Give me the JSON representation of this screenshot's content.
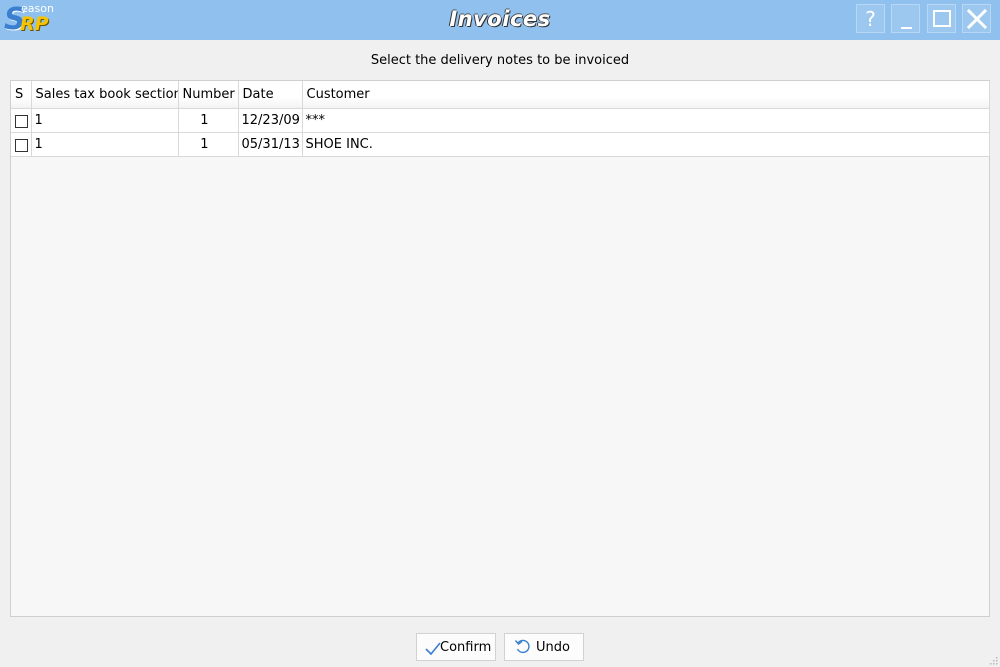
{
  "app": {
    "logo": {
      "big_letter": "S",
      "small_text": "eason",
      "accent_text": "RP"
    },
    "window_title": "Invoices",
    "help_label": "?"
  },
  "prompt": "Select the delivery notes to be invoiced",
  "grid": {
    "columns": [
      "S",
      "Sales tax book section",
      "Number",
      "Date",
      "Customer"
    ],
    "rows": [
      {
        "selected": false,
        "section": "1",
        "number": "1",
        "date": "12/23/09",
        "customer": "***"
      },
      {
        "selected": false,
        "section": "1",
        "number": "1",
        "date": "05/31/13",
        "customer": "SHOE INC."
      }
    ]
  },
  "buttons": {
    "confirm": "Confirm",
    "undo": "Undo"
  },
  "colors": {
    "titlebar": "#8fc0ee",
    "background": "#f0f0f0",
    "accent_icon": "#3a7fd0"
  }
}
